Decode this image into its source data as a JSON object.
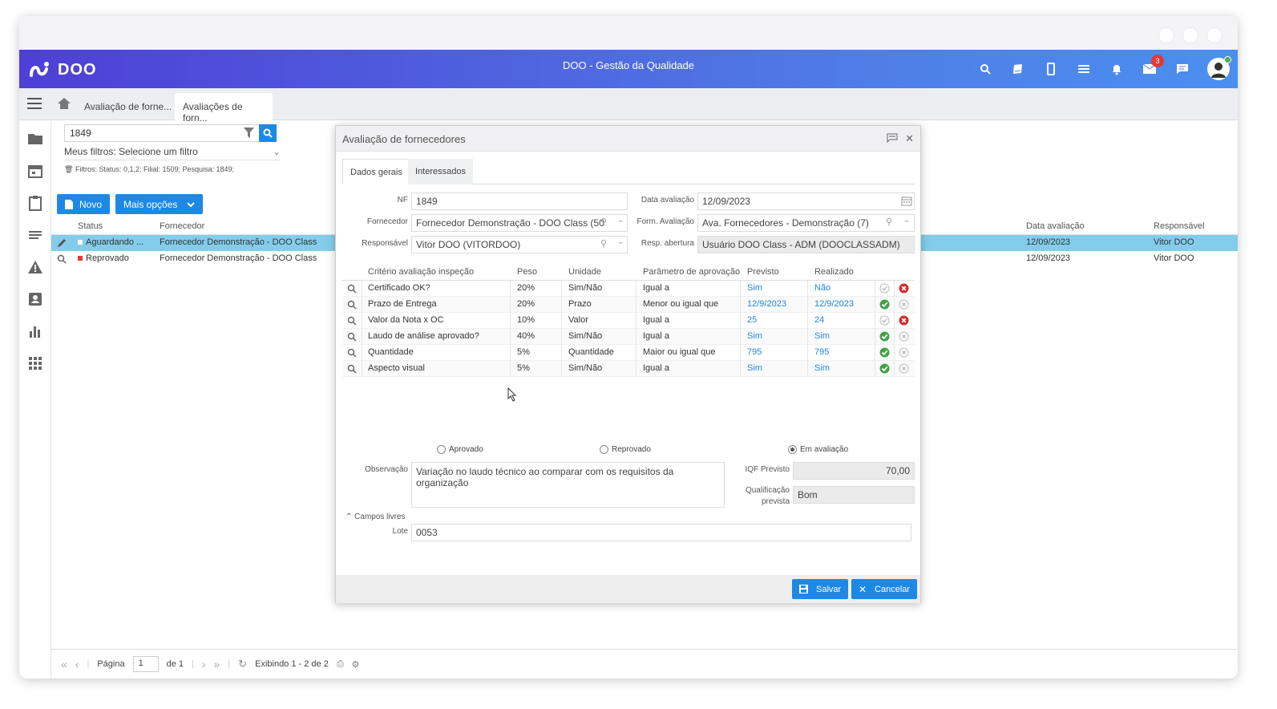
{
  "app": {
    "logo_text": "DOO",
    "title": "DOO - Gestão da Qualidade",
    "notifications_count": "3"
  },
  "tabs": [
    {
      "label": "Avaliação de forne..."
    },
    {
      "label": "Avaliações de forn..."
    }
  ],
  "search": {
    "value": "1849"
  },
  "filters": {
    "my_filters_label": "Meus filtros:",
    "my_filters_value": "Selecione um filtro",
    "summary": "Filtros: Status: 0,1,2; Filial: 1509; Pesquisa: 1849;"
  },
  "buttons": {
    "novo": "Novo",
    "mais": "Mais opções"
  },
  "grid": {
    "headers": {
      "status": "Status",
      "fornecedor": "Fornecedor",
      "data": "Data avaliação",
      "responsavel": "Responsável"
    },
    "rows": [
      {
        "status": "Aguardando ...",
        "status_color": "#ffffff",
        "fornecedor": "Fornecedor Demonstração - DOO Class",
        "data": "12/09/2023",
        "responsavel": "Vitor DOO"
      },
      {
        "status": "Reprovado",
        "status_color": "#e53935",
        "fornecedor": "Fornecedor Demonstração - DOO Class",
        "data": "12/09/2023",
        "responsavel": "Vitor DOO"
      }
    ]
  },
  "footer": {
    "page_label": "Página",
    "page_value": "1",
    "of_label": "de 1",
    "showing": "Exibindo 1 - 2 de 2"
  },
  "dialog": {
    "title": "Avaliação de fornecedores",
    "tabs": [
      "Dados gerais",
      "Interessados"
    ],
    "labels": {
      "nf": "NF",
      "fornecedor": "Fornecedor",
      "responsavel": "Responsável",
      "data": "Data avaliação",
      "form": "Form. Avaliação",
      "resp_abertura": "Resp. abertura",
      "observacao": "Observação",
      "iqf": "IQF Previsto",
      "qualif1": "Qualificação",
      "qualif2": "prevista",
      "campos": "Campos livres",
      "lote": "Lote"
    },
    "values": {
      "nf": "1849",
      "fornecedor": "Fornecedor Demonstração - DOO Class (50",
      "responsavel": "Vitor DOO (VITORDOO)",
      "data": "12/09/2023",
      "form": "Ava. Fornecedores - Demonstração (7)",
      "resp_abertura": "Usuário DOO Class - ADM (DOOCLASSADM)",
      "observacao": "Variação no laudo técnico ao comparar com os requisitos da organização",
      "iqf": "70,00",
      "qualif": "Bom",
      "lote": "0053"
    },
    "criteria_headers": [
      "Critério avaliação inspeção",
      "Peso",
      "Unidade",
      "Parâmetro de aprovação",
      "Previsto",
      "Realizado"
    ],
    "criteria": [
      {
        "criterio": "Certificado OK?",
        "peso": "20%",
        "unidade": "Sim/Não",
        "parametro": "Igual a",
        "previsto": "Sim",
        "realizado": "Não",
        "ok": false
      },
      {
        "criterio": "Prazo de Entrega",
        "peso": "20%",
        "unidade": "Prazo",
        "parametro": "Menor ou igual que",
        "previsto": "12/9/2023",
        "realizado": "12/9/2023",
        "ok": true
      },
      {
        "criterio": "Valor da Nota x OC",
        "peso": "10%",
        "unidade": "Valor",
        "parametro": "Igual a",
        "previsto": "25",
        "realizado": "24",
        "ok": false
      },
      {
        "criterio": "Laudo de análise aprovado?",
        "peso": "40%",
        "unidade": "Sim/Não",
        "parametro": "Igual a",
        "previsto": "Sim",
        "realizado": "Sim",
        "ok": true
      },
      {
        "criterio": "Quantidade",
        "peso": "5%",
        "unidade": "Quantidade",
        "parametro": "Maior ou igual que",
        "previsto": "795",
        "realizado": "795",
        "ok": true
      },
      {
        "criterio": "Aspecto visual",
        "peso": "5%",
        "unidade": "Sim/Não",
        "parametro": "Igual a",
        "previsto": "Sim",
        "realizado": "Sim",
        "ok": true
      }
    ],
    "radios": {
      "aprovado": "Aprovado",
      "reprovado": "Reprovado",
      "em_avaliacao": "Em avaliação",
      "selected": "em_avaliacao"
    },
    "buttons": {
      "salvar": "Salvar",
      "cancelar": "Cancelar"
    }
  }
}
